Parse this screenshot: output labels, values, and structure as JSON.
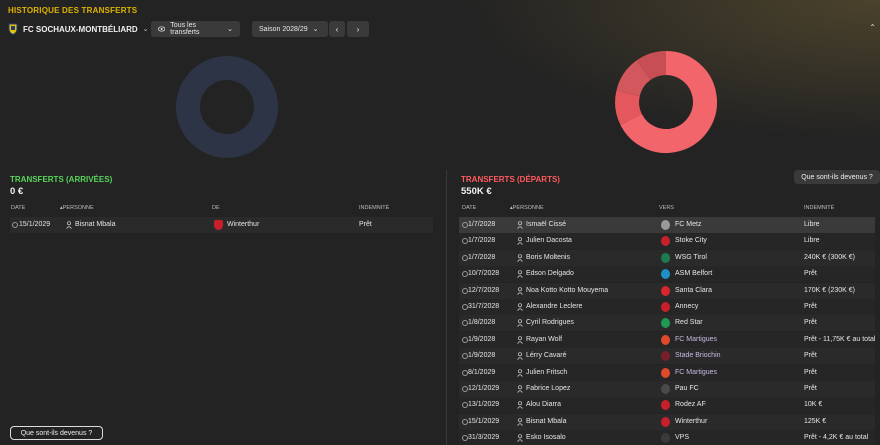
{
  "header": {
    "title": "HISTORIQUE DES TRANSFERTS",
    "club": "FC SOCHAUX-MONTBÉLIARD",
    "filter_label": "Tous les transferts",
    "season_label": "Saison 2028/29",
    "prev_icon": "chevron-left-icon",
    "next_icon": "chevron-right-icon"
  },
  "arrivals": {
    "title": "TRANSFERTS (ARRIVÉES)",
    "total": "0 €",
    "columns": {
      "date": "DATE",
      "person": "PERSONNE",
      "from": "DE",
      "fee": "INDEMNITÉ"
    },
    "rows": [
      {
        "date": "15/1/2029",
        "person": "Bisnat Mbala",
        "club": "Winterthur",
        "fee": "Prêt"
      }
    ],
    "button": "Que sont-ils devenus ?"
  },
  "departures": {
    "title": "TRANSFERTS (DÉPARTS)",
    "total": "550K €",
    "columns": {
      "date": "DATE",
      "person": "PERSONNE",
      "to": "VERS",
      "fee": "INDEMNITÉ"
    },
    "rows": [
      {
        "date": "1/7/2028",
        "person": "Ismaël Cissé",
        "club": "FC Metz",
        "fee": "Libre"
      },
      {
        "date": "1/7/2028",
        "person": "Julien Dacosta",
        "club": "Stoke City",
        "fee": "Libre"
      },
      {
        "date": "1/7/2028",
        "person": "Boris Moltenis",
        "club": "WSG Tirol",
        "fee": "240K € (300K €)"
      },
      {
        "date": "10/7/2028",
        "person": "Edson Delgado",
        "club": "ASM Belfort",
        "fee": "Prêt"
      },
      {
        "date": "12/7/2028",
        "person": "Noa Kotto Kotto Mouyema",
        "club": "Santa Clara",
        "fee": "170K € (230K €)"
      },
      {
        "date": "31/7/2028",
        "person": "Alexandre Leclere",
        "club": "Annecy",
        "fee": "Prêt"
      },
      {
        "date": "1/8/2028",
        "person": "Cyril Rodrigues",
        "club": "Red Star",
        "fee": "Prêt"
      },
      {
        "date": "1/9/2028",
        "person": "Rayan Wolf",
        "club": "FC Martigues",
        "fee": "Prêt - 11,75K € au total"
      },
      {
        "date": "1/9/2028",
        "person": "Lérry Cavaré",
        "club": "Stade Briochin",
        "fee": "Prêt"
      },
      {
        "date": "8/1/2029",
        "person": "Julien Fritsch",
        "club": "FC Martigues",
        "fee": "Prêt"
      },
      {
        "date": "12/1/2029",
        "person": "Fabrice Lopez",
        "club": "Pau FC",
        "fee": "Prêt"
      },
      {
        "date": "13/1/2029",
        "person": "Alou Diarra",
        "club": "Rodez AF",
        "fee": "10K €"
      },
      {
        "date": "15/1/2029",
        "person": "Bisnat Mbala",
        "club": "Winterthur",
        "fee": "125K €"
      },
      {
        "date": "31/3/2029",
        "person": "Esko Isosalo",
        "club": "VPS",
        "fee": "Prêt - 4,2K € au total"
      }
    ],
    "button": "Que sont-ils devenus ?"
  },
  "colors": {
    "accent": "#e0b400",
    "arrivals": "#58d45a",
    "departures": "#ff5a5f",
    "link": "#c9b8e3",
    "donut_empty": "#2d3445",
    "donut_main": "#f2666b"
  }
}
